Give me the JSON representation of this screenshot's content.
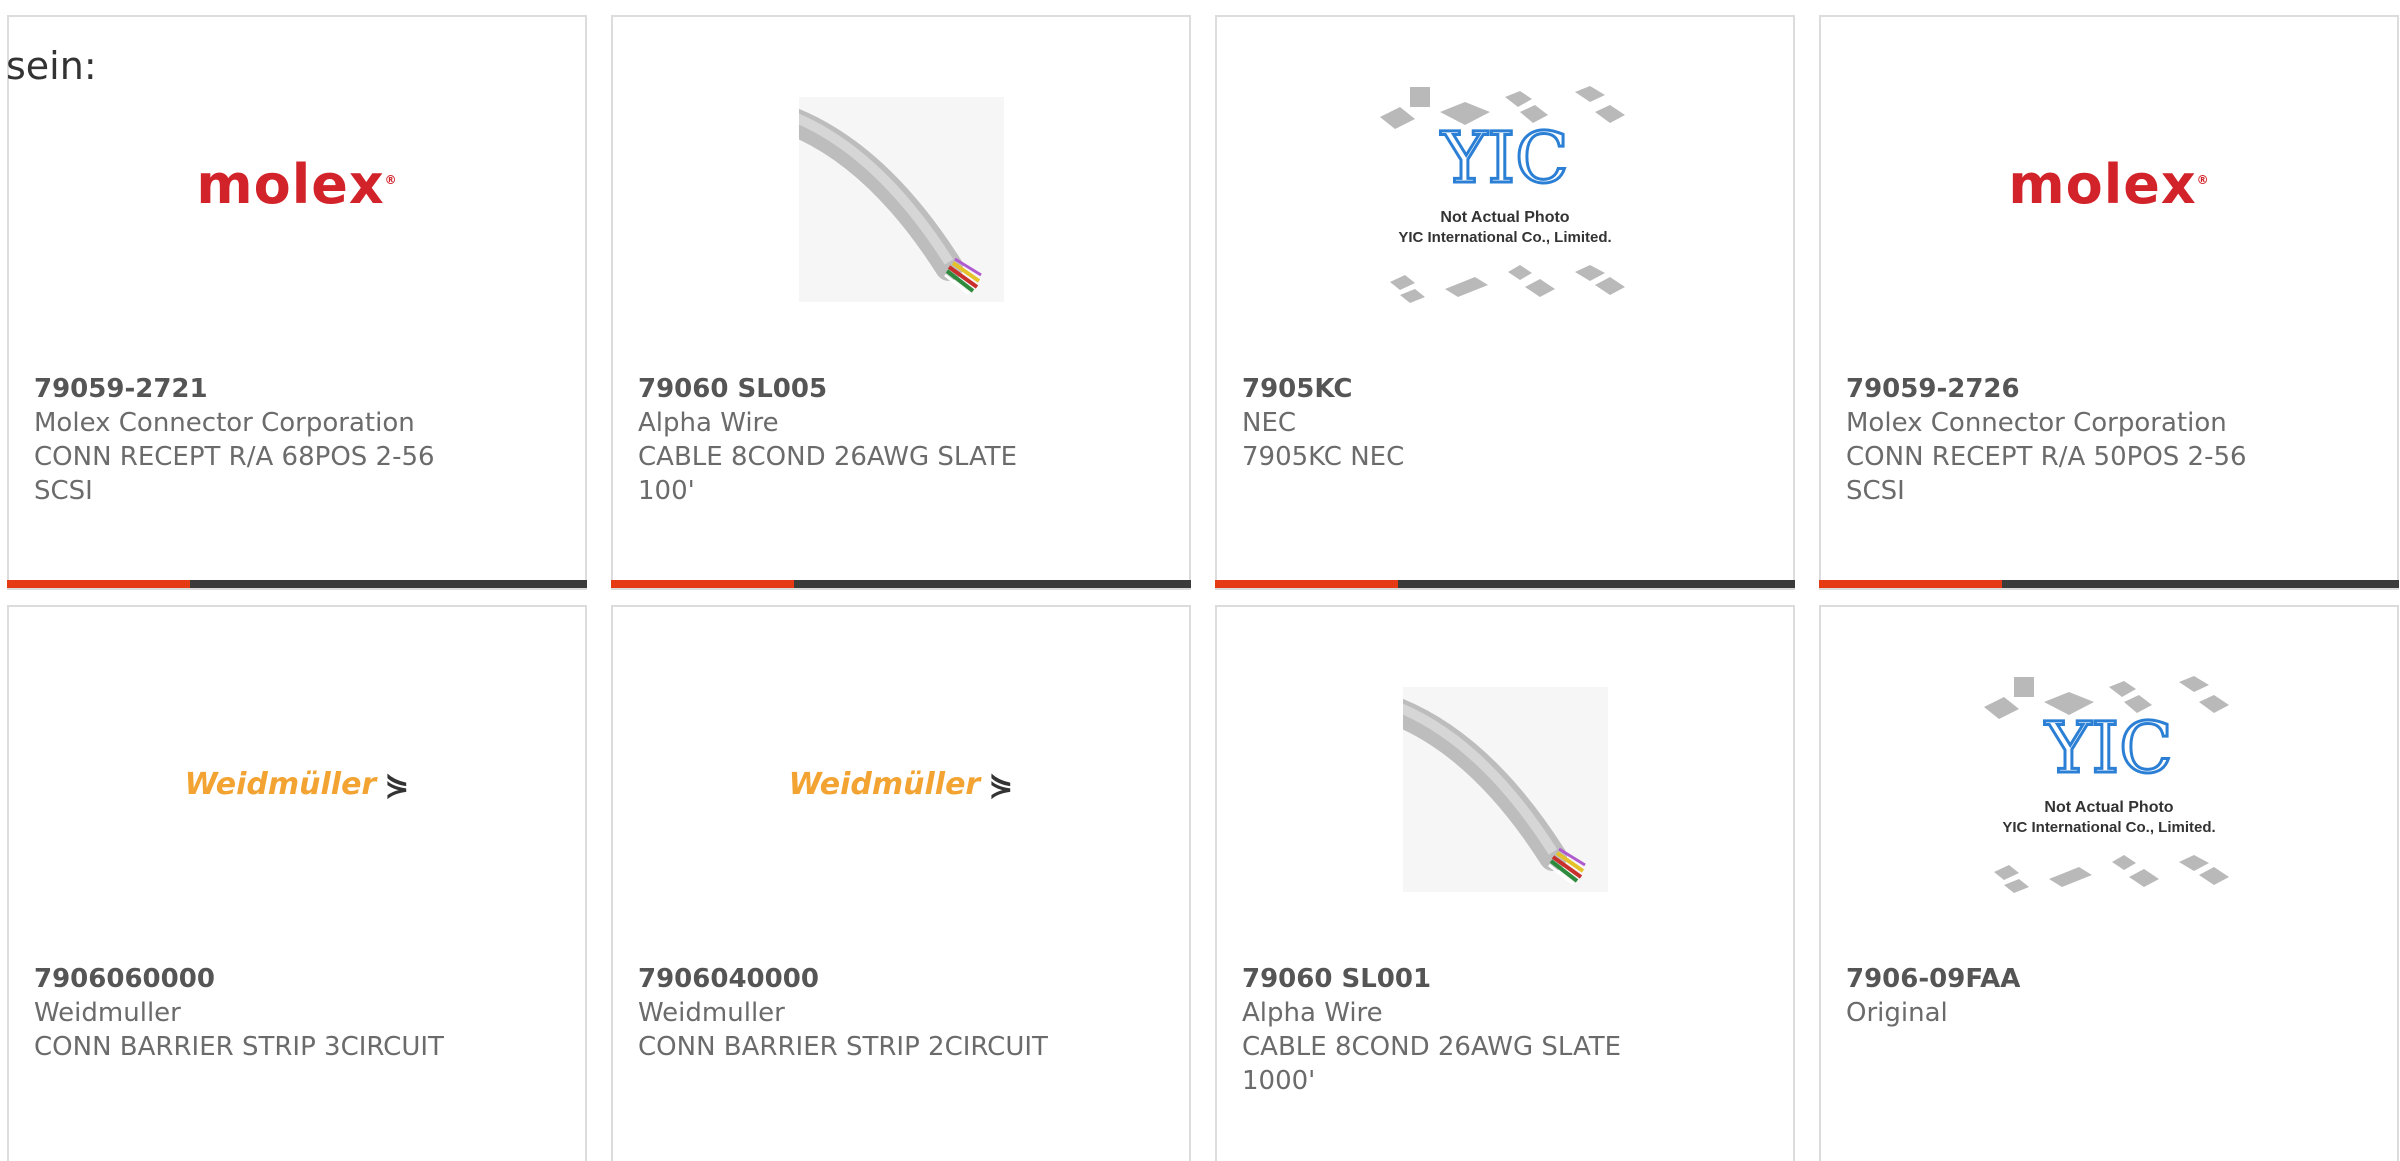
{
  "prefix_text": "sein:",
  "colors": {
    "accent": "#e63a14",
    "bar_dark": "#3b3b3b",
    "molex_red": "#d2232a",
    "weidmuller_orange": "#f2a332",
    "yic_blue": "#2b7fd4"
  },
  "products": [
    {
      "image": "molex-logo",
      "logo_text": "molex",
      "part": "79059-2721",
      "manufacturer": "Molex Connector Corporation",
      "description": "CONN RECEPT R/A 68POS 2-56 SCSI"
    },
    {
      "image": "cable-photo",
      "part": "79060 SL005",
      "manufacturer": "Alpha Wire",
      "description": "CABLE 8COND 26AWG SLATE 100'"
    },
    {
      "image": "yic-placeholder",
      "yic_line1": "Not Actual Photo",
      "yic_line2": "YIC International Co., Limited.",
      "part": "7905KC",
      "manufacturer": "NEC",
      "description": "7905KC NEC"
    },
    {
      "image": "molex-logo",
      "logo_text": "molex",
      "part": "79059-2726",
      "manufacturer": "Molex Connector Corporation",
      "description": "CONN RECEPT R/A 50POS 2-56 SCSI"
    },
    {
      "image": "weidmuller-logo",
      "logo_text": "Weidmüller",
      "part": "7906060000",
      "manufacturer": "Weidmuller",
      "description": "CONN BARRIER STRIP 3CIRCUIT"
    },
    {
      "image": "weidmuller-logo",
      "logo_text": "Weidmüller",
      "part": "7906040000",
      "manufacturer": "Weidmuller",
      "description": "CONN BARRIER STRIP 2CIRCUIT"
    },
    {
      "image": "cable-photo",
      "part": "79060 SL001",
      "manufacturer": "Alpha Wire",
      "description": "CABLE 8COND 26AWG SLATE 1000'"
    },
    {
      "image": "yic-placeholder",
      "yic_line1": "Not Actual Photo",
      "yic_line2": "YIC International Co., Limited.",
      "part": "7906-09FAA",
      "manufacturer": "Original",
      "description": ""
    }
  ]
}
